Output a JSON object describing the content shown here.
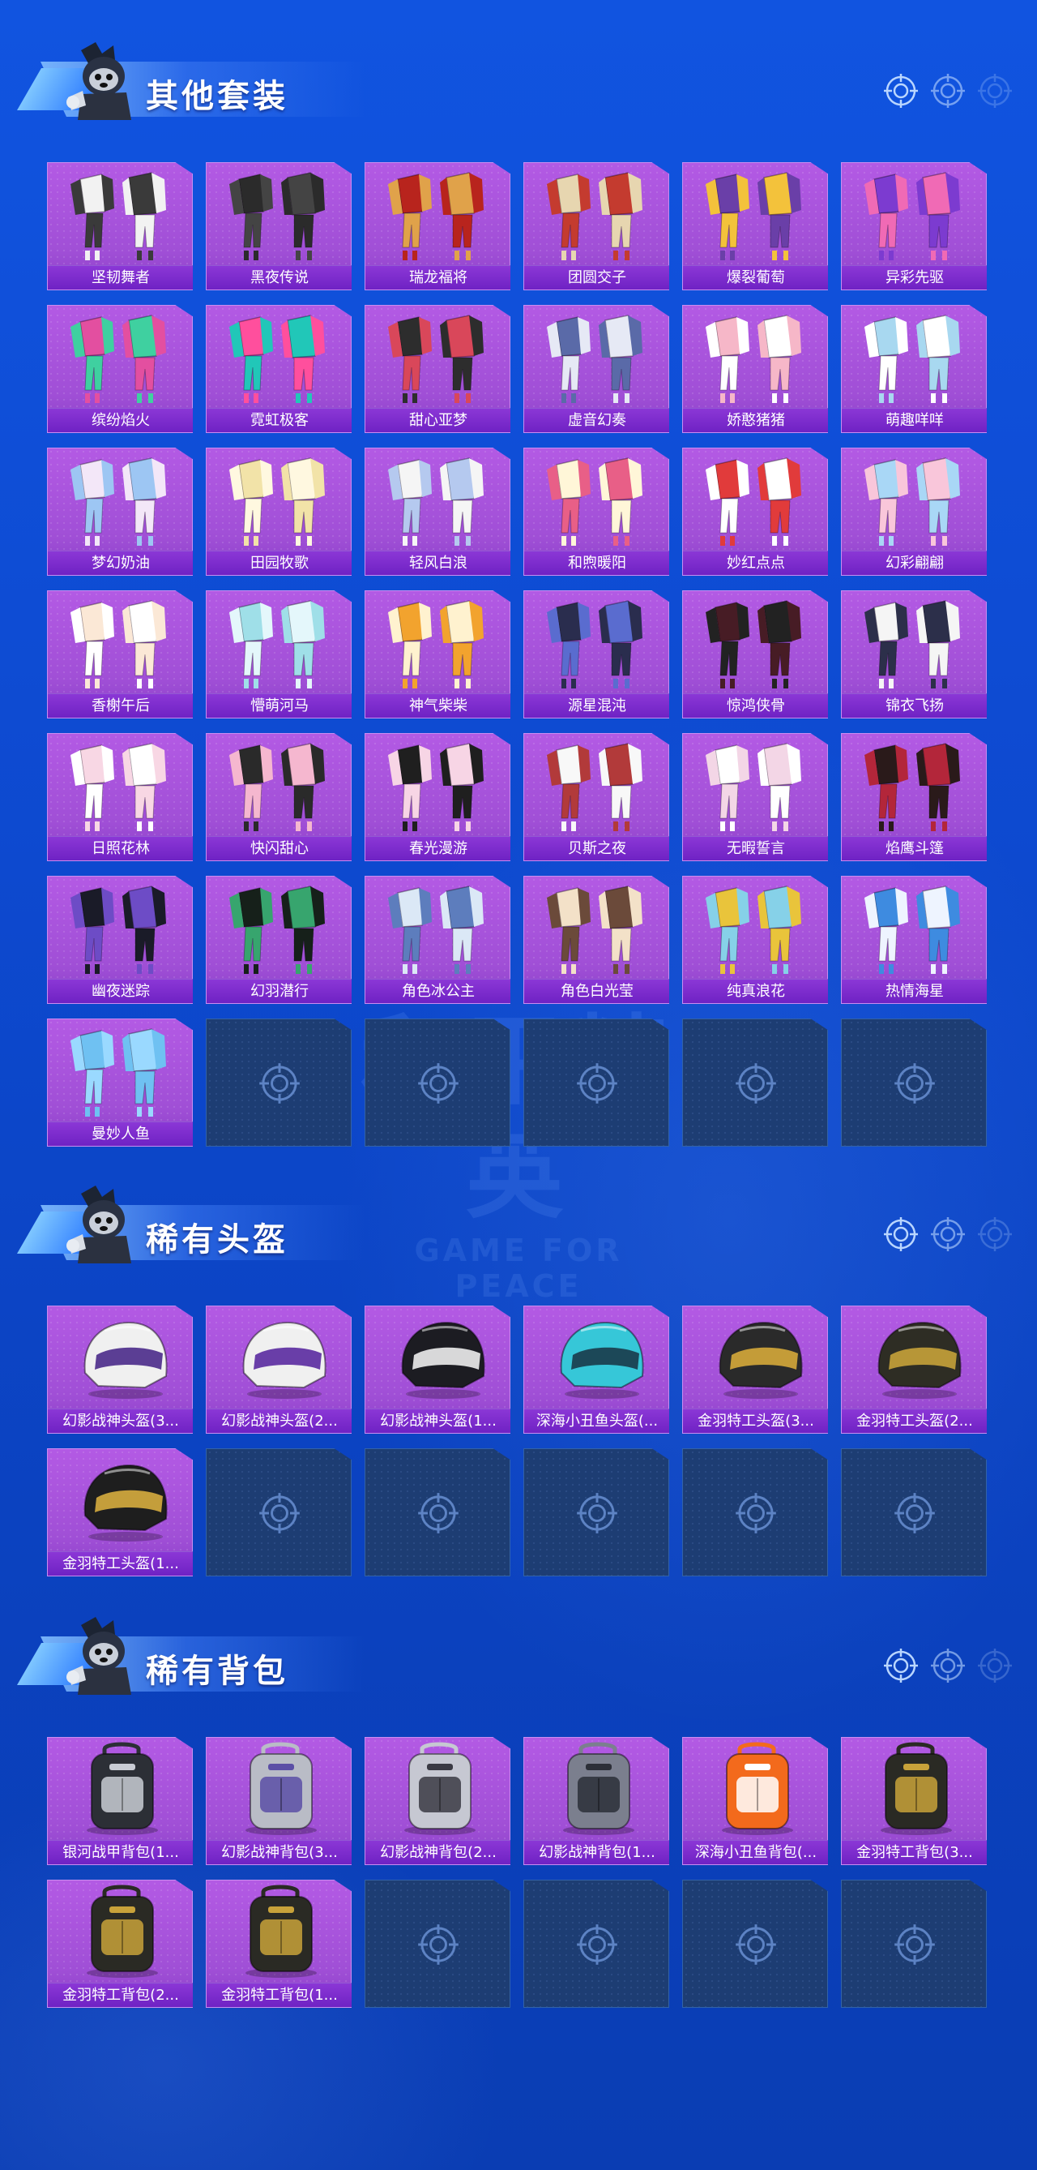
{
  "colors": {
    "background": "#0d49cf",
    "card": "#a04fd6",
    "card_label": "#7a2ccc",
    "empty_slot": "#1d3d73"
  },
  "watermark": {
    "big": "和平精英",
    "small": "GAME FOR PEACE"
  },
  "sections": [
    {
      "title": "其他套装",
      "items": [
        "坚韧舞者",
        "黑夜传说",
        "瑞龙福将",
        "团圆交子",
        "爆裂葡萄",
        "异彩先驱",
        "缤纷焰火",
        "霓虹极客",
        "甜心亚梦",
        "虚音幻奏",
        "娇憨猪猪",
        "萌趣咩咩",
        "梦幻奶油",
        "田园牧歌",
        "轻风白浪",
        "和煦暖阳",
        "妙红点点",
        "幻彩翩翩",
        "香榭午后",
        "懵萌河马",
        "神气柴柴",
        "源星混沌",
        "惊鸿侠骨",
        "锦衣飞扬",
        "日照花林",
        "快闪甜心",
        "春光漫游",
        "贝斯之夜",
        "无暇誓言",
        "焰鹰斗篷",
        "幽夜迷踪",
        "幻羽潜行",
        "角色冰公主",
        "角色白光莹",
        "纯真浪花",
        "热情海星",
        "曼妙人鱼"
      ],
      "empty_slots": 5
    },
    {
      "title": "稀有头盔",
      "items": [
        "幻影战神头盔(3...",
        "幻影战神头盔(2...",
        "幻影战神头盔(1...",
        "深海小丑鱼头盔(...",
        "金羽特工头盔(3...",
        "金羽特工头盔(2...",
        "金羽特工头盔(1..."
      ],
      "empty_slots": 5
    },
    {
      "title": "稀有背包",
      "items": [
        "银河战甲背包(1...",
        "幻影战神背包(3...",
        "幻影战神背包(2...",
        "幻影战神背包(1...",
        "深海小丑鱼背包(...",
        "金羽特工背包(3...",
        "金羽特工背包(2...",
        "金羽特工背包(1..."
      ],
      "empty_slots": 4
    }
  ]
}
